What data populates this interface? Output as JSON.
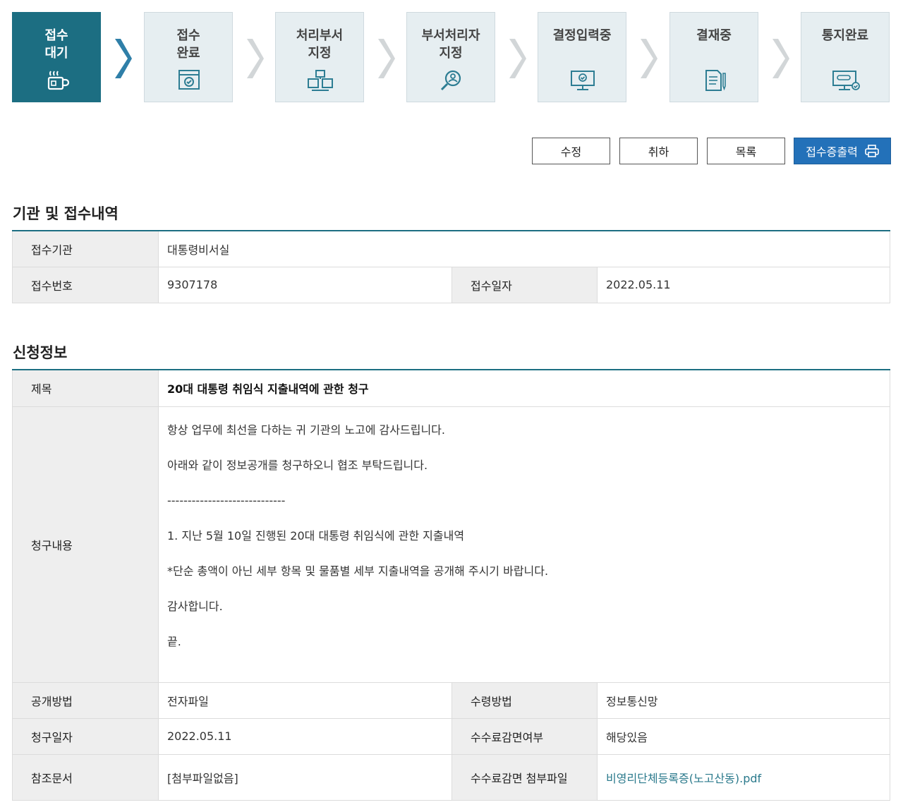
{
  "steps": [
    {
      "label": "접수\n대기",
      "icon": "coffee-cup-icon"
    },
    {
      "label": "접수\n완료",
      "icon": "browser-check-icon"
    },
    {
      "label": "처리부서\n지정",
      "icon": "department-icon"
    },
    {
      "label": "부서처리자\n지정",
      "icon": "person-search-icon"
    },
    {
      "label": "결정입력중",
      "icon": "monitor-check-icon"
    },
    {
      "label": "결재중",
      "icon": "document-pen-icon"
    },
    {
      "label": "통지완료",
      "icon": "monitor-notice-icon"
    }
  ],
  "buttons": {
    "edit": "수정",
    "cancel": "취하",
    "list": "목록",
    "print": "접수증출력"
  },
  "section1": {
    "title": "기관 및 접수내역",
    "agency_label": "접수기관",
    "agency_value": "대통령비서실",
    "number_label": "접수번호",
    "number_value": "9307178",
    "date_label": "접수일자",
    "date_value": "2022.05.11"
  },
  "section2": {
    "title": "신청정보",
    "subject_label": "제목",
    "subject_value": "20대 대통령 취임식 지출내역에 관한 청구",
    "content_label": "청구내용",
    "content_lines": [
      "항상 업무에 최선을 다하는 귀 기관의 노고에 감사드립니다.",
      "아래와 같이 정보공개를 청구하오니 협조 부탁드립니다.",
      "-----------------------------",
      "1. 지난 5월 10일 진행된 20대 대통령 취임식에 관한 지출내역",
      "*단순 총액이 아닌 세부 항목 및 물품별 세부 지출내역을 공개해 주시기 바랍니다.",
      "감사합니다.",
      "끝."
    ],
    "disclosure_label": "공개방법",
    "disclosure_value": "전자파일",
    "receive_label": "수령방법",
    "receive_value": "정보통신망",
    "request_date_label": "청구일자",
    "request_date_value": "2022.05.11",
    "fee_reduction_label": "수수료감면여부",
    "fee_reduction_value": "해당있음",
    "ref_label": "참조문서",
    "ref_value": "[첨부파일없음]",
    "fee_file_label": "수수료감면 첨부파일",
    "fee_file_value": "비영리단체등록증(노고산동).pdf"
  },
  "colors": {
    "accent": "#1c6e82",
    "primary_button": "#2371b9",
    "step_bg": "#e6eef1",
    "link": "#2b7a8c"
  }
}
